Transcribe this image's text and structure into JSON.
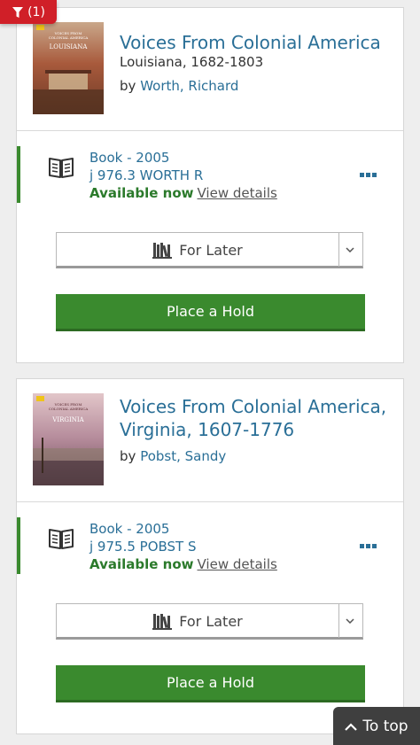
{
  "filter": {
    "count": "(1)"
  },
  "results": [
    {
      "title": "Voices From Colonial America",
      "subtitle": "Louisiana, 1682-1803",
      "by": "by",
      "author": "Worth, Richard",
      "cover": {
        "series": "VOICES FROM COLONIAL AMERICA",
        "name": "LOUISIANA",
        "bg": "#a4553c"
      },
      "format": "Book - 2005",
      "call_number": "j 976.3 WORTH R",
      "availability": "Available now",
      "view_details": "View details",
      "for_later": "For Later",
      "place_hold": "Place a Hold"
    },
    {
      "title": "Voices From Colonial America, Virginia, 1607-1776",
      "by": "by",
      "author": "Pobst, Sandy",
      "cover": {
        "series": "VOICES FROM COLONIAL AMERICA",
        "name": "VIRGINIA",
        "bg": "#b48a9a"
      },
      "format": "Book - 2005",
      "call_number": "j 975.5 POBST S",
      "availability": "Available now",
      "view_details": "View details",
      "for_later": "For Later",
      "place_hold": "Place a Hold"
    }
  ],
  "to_top": "To top",
  "colors": {
    "link": "#2a6f97",
    "green": "#3a8a2e",
    "red": "#d01f28"
  }
}
